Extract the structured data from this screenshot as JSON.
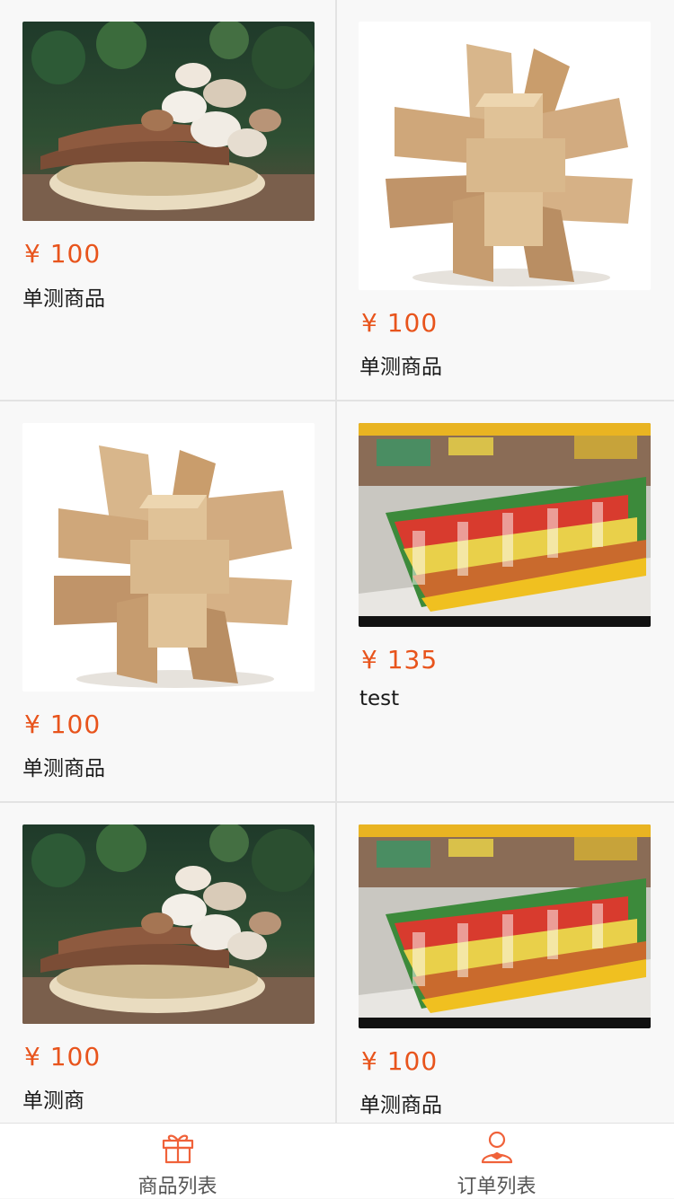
{
  "products": [
    {
      "price": "¥ 100",
      "name": "单测商品",
      "image": "bamboo-shoots-image"
    },
    {
      "price": "¥ 100",
      "name": "单测商品",
      "image": "wooden-puzzle-image"
    },
    {
      "price": "¥ 100",
      "name": "单测商品",
      "image": "wooden-puzzle-image"
    },
    {
      "price": "¥ 135",
      "name": "test",
      "image": "supermarket-image"
    },
    {
      "price": "¥ 100",
      "name": "单测商",
      "image": "bamboo-shoots-image"
    },
    {
      "price": "¥ 100",
      "name": "单测商品",
      "image": "supermarket-image"
    }
  ],
  "tabbar": {
    "items": [
      {
        "label": "商品列表",
        "icon": "gift-icon"
      },
      {
        "label": "订单列表",
        "icon": "user-icon"
      }
    ]
  },
  "colors": {
    "price": "#e8541c",
    "tab_icon": "#f0623a",
    "background": "#f8f8f8"
  }
}
